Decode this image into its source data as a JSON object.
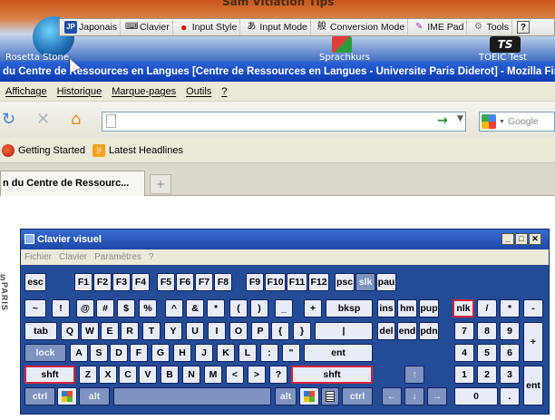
{
  "desktop": {
    "top_title": "Sam Vitiation Tips",
    "label_left": "Rosetta Stone",
    "label_mid": "Sprachkurs",
    "label_right": "TOEIC Test"
  },
  "language_bar": {
    "items": [
      {
        "label": "Japonais",
        "icon": "JP"
      },
      {
        "label": "Clavier",
        "icon": "keyboard-icon"
      },
      {
        "label": "Input Style",
        "icon": "input-style-icon"
      },
      {
        "label": "Input Mode",
        "icon": "あ"
      },
      {
        "label": "Conversion Mode",
        "icon": "般"
      },
      {
        "label": "IME Pad",
        "icon": "ime-pad-icon"
      },
      {
        "label": "Tools",
        "icon": "tools-icon"
      },
      {
        "label": "",
        "icon": "help-icon"
      }
    ]
  },
  "browser": {
    "title": "du Centre de Ressources en Langues [Centre de Ressources en Langues - Universite Paris Diderot] - Mozilla Firefox",
    "menu": [
      "Affichage",
      "Historique",
      "Marque-pages",
      "Outils",
      "?"
    ],
    "url": "",
    "search_placeholder": "Google",
    "bookmarks": [
      "Getting Started",
      "Latest Headlines"
    ],
    "tab_title": "n du Centre de Ressourc..."
  },
  "page_fragments": [
    "S",
    "PARIS"
  ],
  "keyboard": {
    "title": "Clavier visuel",
    "menu": [
      "Fichier",
      "Clavier",
      "Paramètres",
      "?"
    ],
    "highlight_color": "#d4243a",
    "rows": [
      [
        "esc",
        "F1",
        "F2",
        "F3",
        "F4",
        "F5",
        "F6",
        "F7",
        "F8",
        "F9",
        "F10",
        "F11",
        "F12",
        "psc",
        "slk",
        "pau"
      ],
      [
        "~",
        "!",
        "@",
        "#",
        "$",
        "%",
        "^",
        "&",
        "*",
        "(",
        ")",
        "_",
        "+",
        "bksp",
        "ins",
        "hm",
        "pup",
        "nlk",
        "/",
        "*",
        "-"
      ],
      [
        "tab",
        "Q",
        "W",
        "E",
        "R",
        "T",
        "Y",
        "U",
        "I",
        "O",
        "P",
        "{",
        "}",
        "|",
        "del",
        "end",
        "pdn",
        "7",
        "8",
        "9",
        "+"
      ],
      [
        "lock",
        "A",
        "S",
        "D",
        "F",
        "G",
        "H",
        "J",
        "K",
        "L",
        ":",
        "\"",
        "ent",
        "4",
        "5",
        "6"
      ],
      [
        "shft",
        "Z",
        "X",
        "C",
        "V",
        "B",
        "N",
        "M",
        "<",
        ">",
        "?",
        "shft",
        "↑",
        "1",
        "2",
        "3",
        "ent"
      ],
      [
        "ctrl",
        "alt",
        "alt",
        "ctrl",
        "←",
        "↓",
        "→",
        "0",
        "."
      ]
    ]
  }
}
